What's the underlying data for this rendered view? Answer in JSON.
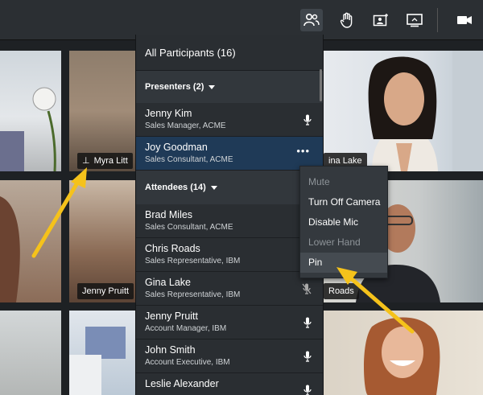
{
  "toolbar": {
    "icons": [
      "participants-icon",
      "raise-hand-icon",
      "share-content-icon",
      "screen-share-icon",
      "camera-icon"
    ]
  },
  "panel": {
    "header": "All Participants (16)",
    "presenters_label": "Presenters (2)",
    "attendees_label": "Attendees (14)",
    "presenters": [
      {
        "name": "Jenny Kim",
        "role": "Sales Manager, ACME",
        "status": "mic"
      },
      {
        "name": "Joy Goodman",
        "role": "Sales Consultant, ACME",
        "status": "more"
      }
    ],
    "attendees": [
      {
        "name": "Brad Miles",
        "role": "Sales Consultant, ACME",
        "status": "none"
      },
      {
        "name": "Chris Roads",
        "role": "Sales Representative, IBM",
        "status": "none"
      },
      {
        "name": "Gina Lake",
        "role": "Sales Representative, IBM",
        "status": "mic-off"
      },
      {
        "name": "Jenny Pruitt",
        "role": "Account Manager, IBM",
        "status": "mic"
      },
      {
        "name": "John Smith",
        "role": "Account Executive, IBM",
        "status": "mic"
      },
      {
        "name": "Leslie Alexander",
        "role": "",
        "status": "mic"
      }
    ]
  },
  "context_menu": {
    "items": [
      {
        "label": "Mute",
        "enabled": false
      },
      {
        "label": "Turn Off Camera",
        "enabled": true
      },
      {
        "label": "Disable Mic",
        "enabled": true
      },
      {
        "label": "Lower Hand",
        "enabled": false
      },
      {
        "label": "Pin",
        "enabled": true
      }
    ]
  },
  "tiles": {
    "myra": "Myra Litt",
    "gina": "ina Lake",
    "jenny": "Jenny Pruitt",
    "chris": "Roads"
  },
  "colors": {
    "accent_arrow": "#f5c21b",
    "selected_row": "#1f3a57",
    "panel_bg": "#2a2e32"
  }
}
